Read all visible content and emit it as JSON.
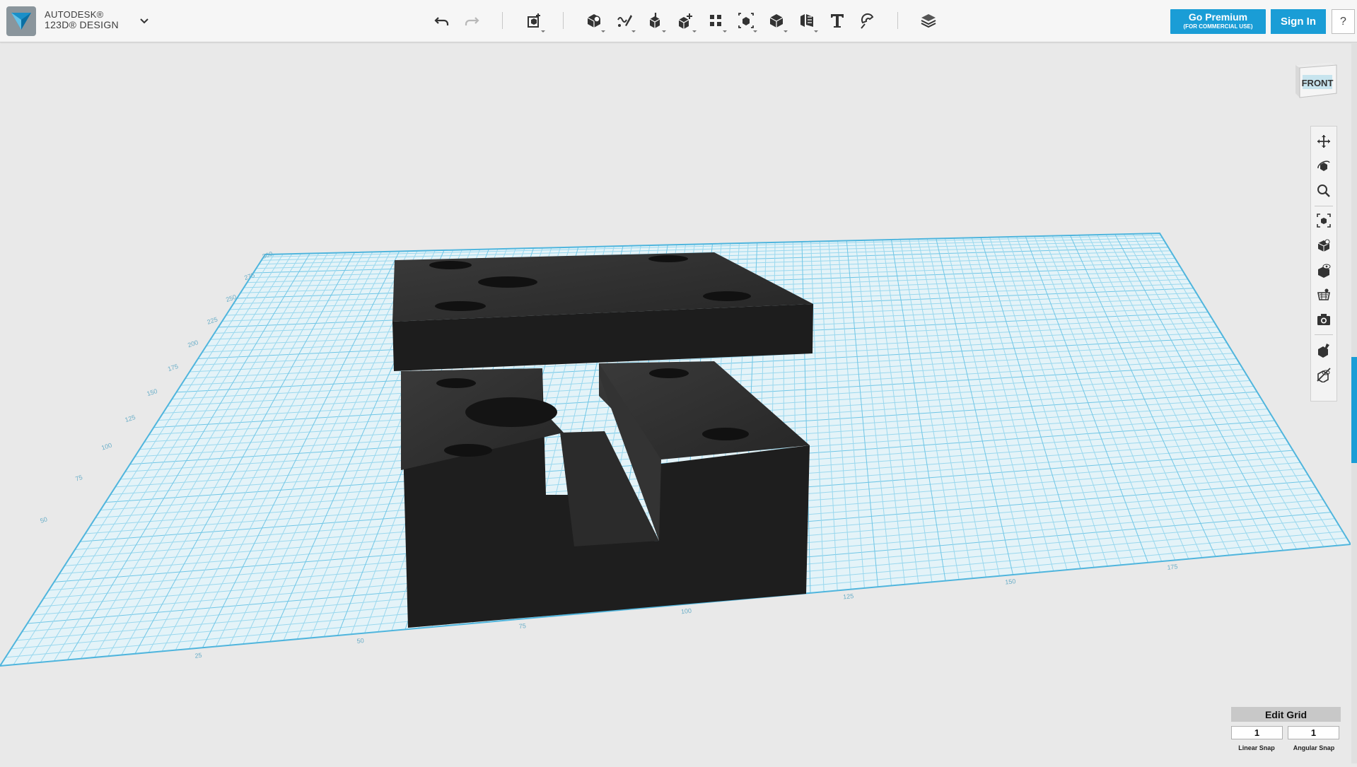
{
  "app": {
    "brand_line1": "AUTODESK®",
    "brand_line2": "123D® DESIGN"
  },
  "toolbar": {
    "tools": [
      {
        "name": "undo-button",
        "icon": "undo-icon"
      },
      {
        "name": "redo-button",
        "icon": "redo-icon"
      },
      {
        "name": "transform-button",
        "icon": "transform-icon"
      },
      {
        "name": "primitives-button",
        "icon": "primitives-icon"
      },
      {
        "name": "sketch-button",
        "icon": "sketch-icon"
      },
      {
        "name": "construct-button",
        "icon": "construct-icon"
      },
      {
        "name": "modify-button",
        "icon": "modify-icon"
      },
      {
        "name": "pattern-button",
        "icon": "pattern-icon"
      },
      {
        "name": "grouping-button",
        "icon": "grouping-icon"
      },
      {
        "name": "combine-button",
        "icon": "combine-icon"
      },
      {
        "name": "measure-button",
        "icon": "measure-icon"
      },
      {
        "name": "text-button",
        "icon": "text-icon"
      },
      {
        "name": "snap-button",
        "icon": "snap-icon"
      },
      {
        "name": "material-button",
        "icon": "material-icon"
      }
    ]
  },
  "header": {
    "premium_label": "Go Premium",
    "premium_sublabel": "(FOR COMMERCIAL USE)",
    "signin_label": "Sign In",
    "help_label": "?"
  },
  "viewcube": {
    "face_label": "FRONT"
  },
  "navbar": {
    "tools": [
      "pan-icon",
      "orbit-icon",
      "zoom-icon",
      "fit-icon",
      "views-icon",
      "visibility-icon",
      "material-view-icon",
      "screenshot-icon",
      "hide-icon",
      "show-all-icon"
    ]
  },
  "grid": {
    "edit_grid_label": "Edit Grid",
    "linear_snap_value": "1",
    "angular_snap_value": "1",
    "linear_snap_label": "Linear Snap",
    "angular_snap_label": "Angular Snap",
    "x_axis_ticks": [
      "25",
      "50",
      "75",
      "100",
      "125",
      "150",
      "175"
    ],
    "y_axis_ticks": [
      "50",
      "75",
      "100",
      "125",
      "150",
      "175",
      "200",
      "225",
      "250",
      "275",
      "300"
    ],
    "grid_color": "#7fd0ec",
    "accent_color": "#1a9dd6"
  }
}
